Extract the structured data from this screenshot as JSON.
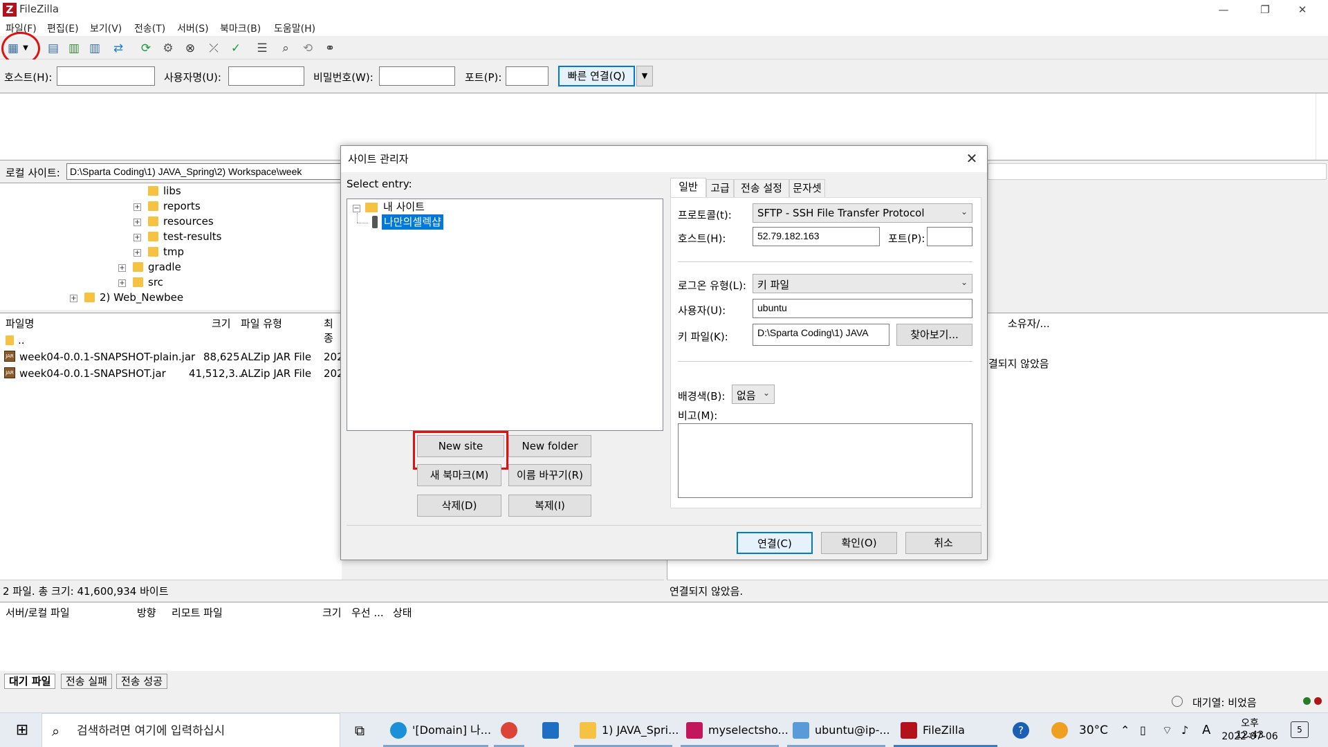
{
  "window": {
    "title": "FileZilla",
    "minimize": "—",
    "restore": "❐",
    "close": "✕"
  },
  "menu": [
    "파일(F)",
    "편집(E)",
    "보기(V)",
    "전송(T)",
    "서버(S)",
    "북마크(B)",
    "도움말(H)"
  ],
  "quickconnect": {
    "host_label": "호스트(H):",
    "user_label": "사용자명(U):",
    "pass_label": "비밀번호(W):",
    "port_label": "포트(P):",
    "button": "빠른 연결(Q)",
    "host_value": "",
    "user_value": "",
    "pass_value": "",
    "port_value": ""
  },
  "local": {
    "label": "로컬 사이트:",
    "path": "D:\\Sparta Coding\\1) JAVA_Spring\\2) Workspace\\week",
    "tree": [
      {
        "name": "libs",
        "expandable": false
      },
      {
        "name": "reports",
        "expandable": true
      },
      {
        "name": "resources",
        "expandable": true
      },
      {
        "name": "test-results",
        "expandable": true
      },
      {
        "name": "tmp",
        "expandable": true
      },
      {
        "name": "gradle",
        "expandable": true
      },
      {
        "name": "src",
        "expandable": true
      },
      {
        "name": "2) Web_Newbee",
        "expandable": true
      }
    ],
    "columns": [
      "파일명",
      "크기",
      "파일 유형",
      "최종"
    ],
    "files": [
      {
        "name": "..",
        "size": "",
        "type": "",
        "date": ""
      },
      {
        "name": "week04-0.0.1-SNAPSHOT-plain.jar",
        "size": "88,625",
        "type": "ALZip JAR File",
        "date": "202"
      },
      {
        "name": "week04-0.0.1-SNAPSHOT.jar",
        "size": "41,512,3...",
        "type": "ALZip JAR File",
        "date": "202"
      }
    ],
    "status": "2 파일. 총 크기: 41,600,934 바이트"
  },
  "remote": {
    "owner_col": "소유자/...",
    "not_connected": "결되지 않았음",
    "status": "연결되지 않았음."
  },
  "queue": {
    "columns": [
      "서버/로컬 파일",
      "방향",
      "리모트 파일",
      "크기",
      "우선 ...",
      "상태"
    ],
    "tabs": [
      "대기 파일",
      "전송 실패",
      "전송 성공"
    ],
    "status": "대기열: 비었음"
  },
  "dialog": {
    "title": "사이트 관리자",
    "select_entry": "Select entry:",
    "root_folder": "내 사이트",
    "site": "나만의셀렉샵",
    "buttons": {
      "new_site": "New site",
      "new_folder": "New folder",
      "new_bookmark": "새 북마크(M)",
      "rename": "이름 바꾸기(R)",
      "delete": "삭제(D)",
      "duplicate": "복제(I)",
      "connect": "연결(C)",
      "ok": "확인(O)",
      "cancel": "취소"
    },
    "tabs": [
      "일반",
      "고급",
      "전송 설정",
      "문자셋"
    ],
    "general": {
      "protocol_label": "프로토콜(t):",
      "protocol_value": "SFTP - SSH File Transfer Protocol",
      "host_label": "호스트(H):",
      "host_value": "52.79.182.163",
      "port_label": "포트(P):",
      "port_value": "",
      "logon_label": "로그온 유형(L):",
      "logon_value": "키 파일",
      "user_label": "사용자(U):",
      "user_value": "ubuntu",
      "keyfile_label": "키 파일(K):",
      "keyfile_value": "D:\\Sparta Coding\\1) JAVA",
      "browse": "찾아보기...",
      "bgcolor_label": "배경색(B):",
      "bgcolor_value": "없음",
      "comment_label": "비고(M):",
      "comment_value": ""
    }
  },
  "taskbar": {
    "search_placeholder": "검색하려면 여기에 입력하십시",
    "apps": [
      {
        "label": "'[Domain] 나...",
        "icon": "edge-icon"
      },
      {
        "label": "",
        "icon": "chrome-icon"
      },
      {
        "label": "",
        "icon": "mail-icon"
      },
      {
        "label": "1) JAVA_Spri...",
        "icon": "folder-icon"
      },
      {
        "label": "myselectsho...",
        "icon": "intellij-icon"
      },
      {
        "label": "ubuntu@ip-...",
        "icon": "terminal-icon"
      },
      {
        "label": "FileZilla",
        "icon": "filezilla-icon"
      }
    ],
    "temperature": "30°C",
    "ime": "A",
    "time": "오후 12:43",
    "date": "2022-07-06",
    "notifications": "5"
  },
  "colors": {
    "accent": "#0078d7",
    "highlight_red": "#e01010",
    "selection": "#0078d7",
    "filezilla_red": "#b3121a"
  }
}
